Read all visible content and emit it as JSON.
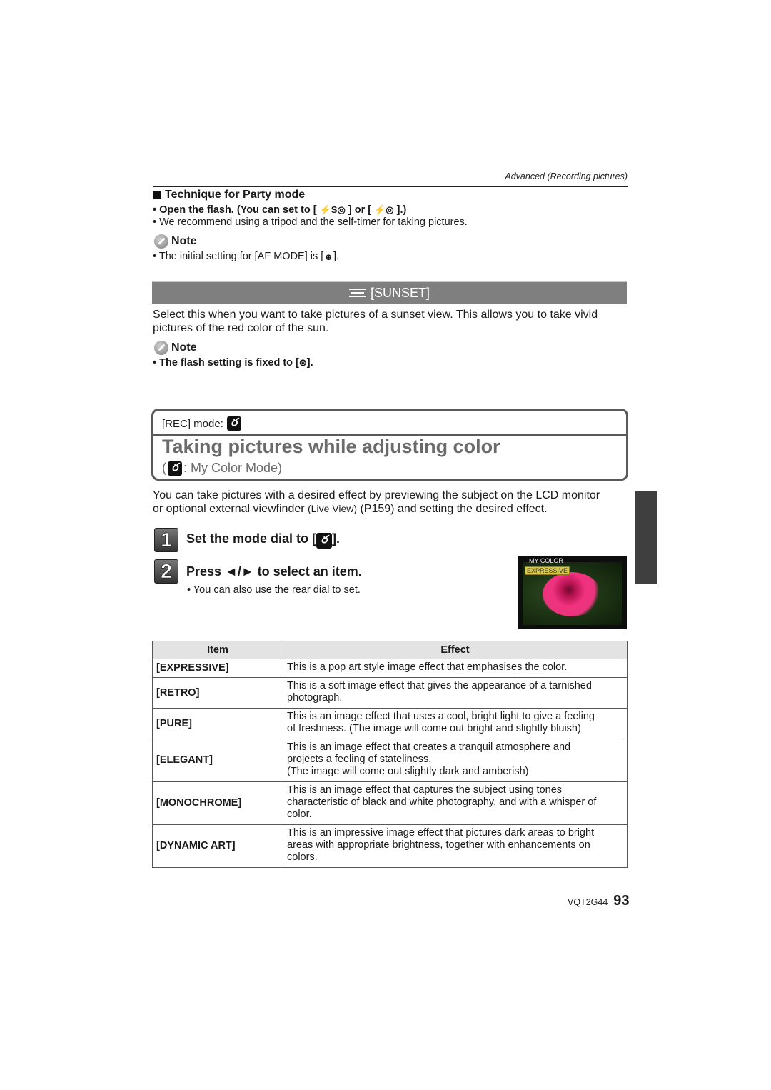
{
  "header": {
    "breadcrumb": "Advanced (Recording pictures)"
  },
  "party": {
    "title": "Technique for Party mode",
    "bullet1_prefix": "• Open the flash. (You can set to [",
    "bullet1_icon1": "⚡S◎",
    "bullet1_mid": "] or [",
    "bullet1_icon2": "⚡◎",
    "bullet1_suffix": "].)",
    "bullet2": "• We recommend using a tripod and the self-timer for taking pictures.",
    "note_label": "Note",
    "note_text_prefix": "• The initial setting for [AF MODE] is [",
    "note_icon": "☻",
    "note_text_suffix": "]."
  },
  "sunset": {
    "bar_label": "[SUNSET]",
    "description_line1": "Select this when you want to take pictures of a sunset view. This allows you to take vivid",
    "description_line2": "pictures of the red color of the sun.",
    "note_label": "Note",
    "note_text_prefix": "• The flash setting is fixed to [",
    "note_icon": "⊛",
    "note_text_suffix": "]."
  },
  "section": {
    "rec_mode_label": "[REC] mode:",
    "mode_icon_glyph": "ర",
    "title": "Taking pictures while adjusting color",
    "subtitle_open": "(",
    "subtitle_text": ": My Color Mode)",
    "intro_line1": "You can take pictures with a desired effect by previewing the subject on the LCD monitor",
    "intro_line2_a": "or optional external viewfinder ",
    "intro_line2_b": "(Live View)",
    "intro_line2_c": " (P159) and setting the desired effect."
  },
  "steps": [
    {
      "number": "1",
      "text_prefix": "Set the mode dial to [",
      "text_suffix": "]."
    },
    {
      "number": "2",
      "text": "Press ◄/► to select an item.",
      "sub_bullet": "•  You can also use the rear dial to set."
    }
  ],
  "preview": {
    "screen_title": "MY COLOR",
    "selected_item": "EXPRESSIVE"
  },
  "table": {
    "headers": [
      "Item",
      "Effect"
    ],
    "rows": [
      {
        "item": "[EXPRESSIVE]",
        "effect": [
          "This is a pop art style image effect that emphasises the color."
        ]
      },
      {
        "item": "[RETRO]",
        "effect": [
          "This is a soft image effect that gives the appearance of a tarnished",
          "photograph."
        ]
      },
      {
        "item": "[PURE]",
        "effect": [
          "This is an image effect that uses a cool, bright light to give a feeling",
          "of freshness. (The image will come out bright and slightly bluish)"
        ]
      },
      {
        "item": "[ELEGANT]",
        "effect": [
          "This is an image effect that creates a tranquil atmosphere and",
          "projects a feeling of stateliness.",
          "(The image will come out slightly dark and amberish)"
        ]
      },
      {
        "item": "[MONOCHROME]",
        "effect": [
          "This is an image effect that captures the subject using tones",
          "characteristic of black and white photography, and with a whisper of",
          "color."
        ]
      },
      {
        "item": "[DYNAMIC ART]",
        "effect": [
          "This is an impressive image effect that pictures dark areas to bright",
          "areas with appropriate brightness, together with enhancements on",
          "colors."
        ]
      }
    ]
  },
  "footer": {
    "model_code": "VQT2G44",
    "page_number": "93"
  }
}
